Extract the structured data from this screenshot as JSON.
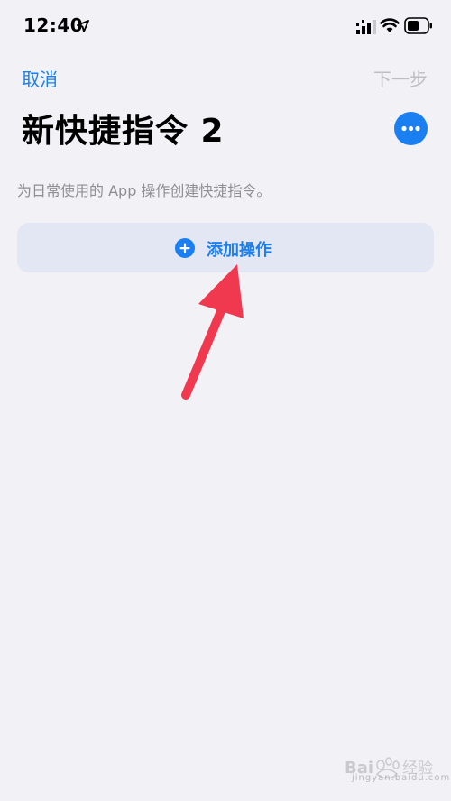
{
  "status_bar": {
    "time": "12:40",
    "icons": [
      "location-arrow-icon",
      "cellular-signal-icon",
      "wifi-icon",
      "battery-icon"
    ]
  },
  "nav": {
    "cancel_label": "取消",
    "next_label": "下一步"
  },
  "header": {
    "title": "新快捷指令 2",
    "more_icon": "ellipsis-icon"
  },
  "description": "为日常使用的 App 操作创建快捷指令。",
  "add_action": {
    "label": "添加操作",
    "icon": "plus-circle-icon"
  },
  "annotation": {
    "arrow_color": "#f0384f"
  },
  "watermark": {
    "logo_text": "Bai经验",
    "url_text": "jingyan.baidu.com"
  },
  "colors": {
    "accent": "#1a7ff0",
    "background": "#f1f1f6",
    "button_bg": "#e2e7f3",
    "disabled": "#bdbdc2"
  }
}
